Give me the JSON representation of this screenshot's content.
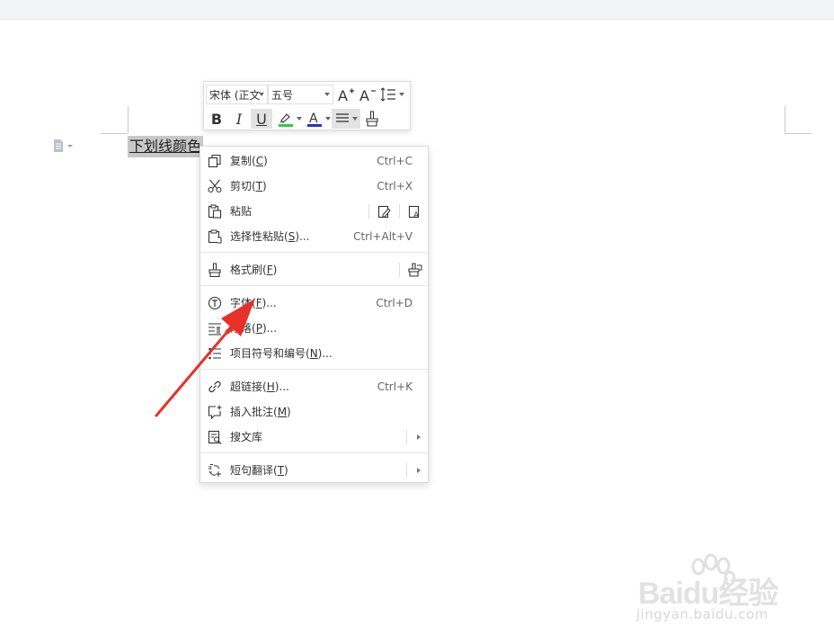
{
  "document": {
    "selected_text": "下划线颜色"
  },
  "mini_toolbar": {
    "font_name": "宋体 (正文",
    "font_size": "五号",
    "grow_font_label": "A",
    "shrink_font_label": "A",
    "bold_label": "B",
    "italic_label": "I",
    "underline_label": "U",
    "font_color_label": "A",
    "highlight_color": "#2ecc40",
    "font_color": "#2233cc"
  },
  "context_menu": {
    "items": [
      {
        "label": "复制(",
        "mnemonic": "C",
        "suffix": ")",
        "shortcut": "Ctrl+C",
        "icon": "copy-icon"
      },
      {
        "label": "剪切(",
        "mnemonic": "T",
        "suffix": ")",
        "shortcut": "Ctrl+X",
        "icon": "scissors-icon"
      },
      {
        "label": "粘贴",
        "mnemonic": "",
        "suffix": "",
        "shortcut": "",
        "icon": "paste-icon"
      },
      {
        "label": "选择性粘贴(",
        "mnemonic": "S",
        "suffix": ")...",
        "shortcut": "Ctrl+Alt+V",
        "icon": "paste-special-icon"
      },
      {
        "label": "格式刷(",
        "mnemonic": "F",
        "suffix": ")",
        "shortcut": "",
        "icon": "format-painter-icon"
      },
      {
        "label": "字体(",
        "mnemonic": "F",
        "suffix": ")...",
        "shortcut": "Ctrl+D",
        "icon": "font-icon"
      },
      {
        "label": "段落(",
        "mnemonic": "P",
        "suffix": ")...",
        "shortcut": "",
        "icon": "paragraph-icon"
      },
      {
        "label": "项目符号和编号(",
        "mnemonic": "N",
        "suffix": ")...",
        "shortcut": "",
        "icon": "bullets-icon"
      },
      {
        "label": "超链接(",
        "mnemonic": "H",
        "suffix": ")...",
        "shortcut": "Ctrl+K",
        "icon": "link-icon"
      },
      {
        "label": "插入批注(",
        "mnemonic": "M",
        "suffix": ")",
        "shortcut": "",
        "icon": "comment-icon"
      },
      {
        "label": "搜文库",
        "mnemonic": "",
        "suffix": "",
        "shortcut": "",
        "icon": "search-library-icon"
      },
      {
        "label": "短句翻译(",
        "mnemonic": "T",
        "suffix": ")",
        "shortcut": "",
        "icon": "translate-icon"
      }
    ]
  },
  "watermark": {
    "brand": "Baidu经验",
    "url": "jingyan.baidu.com"
  },
  "colors": {
    "arrow": "#e8302a",
    "selection": "#c8c8c8"
  }
}
